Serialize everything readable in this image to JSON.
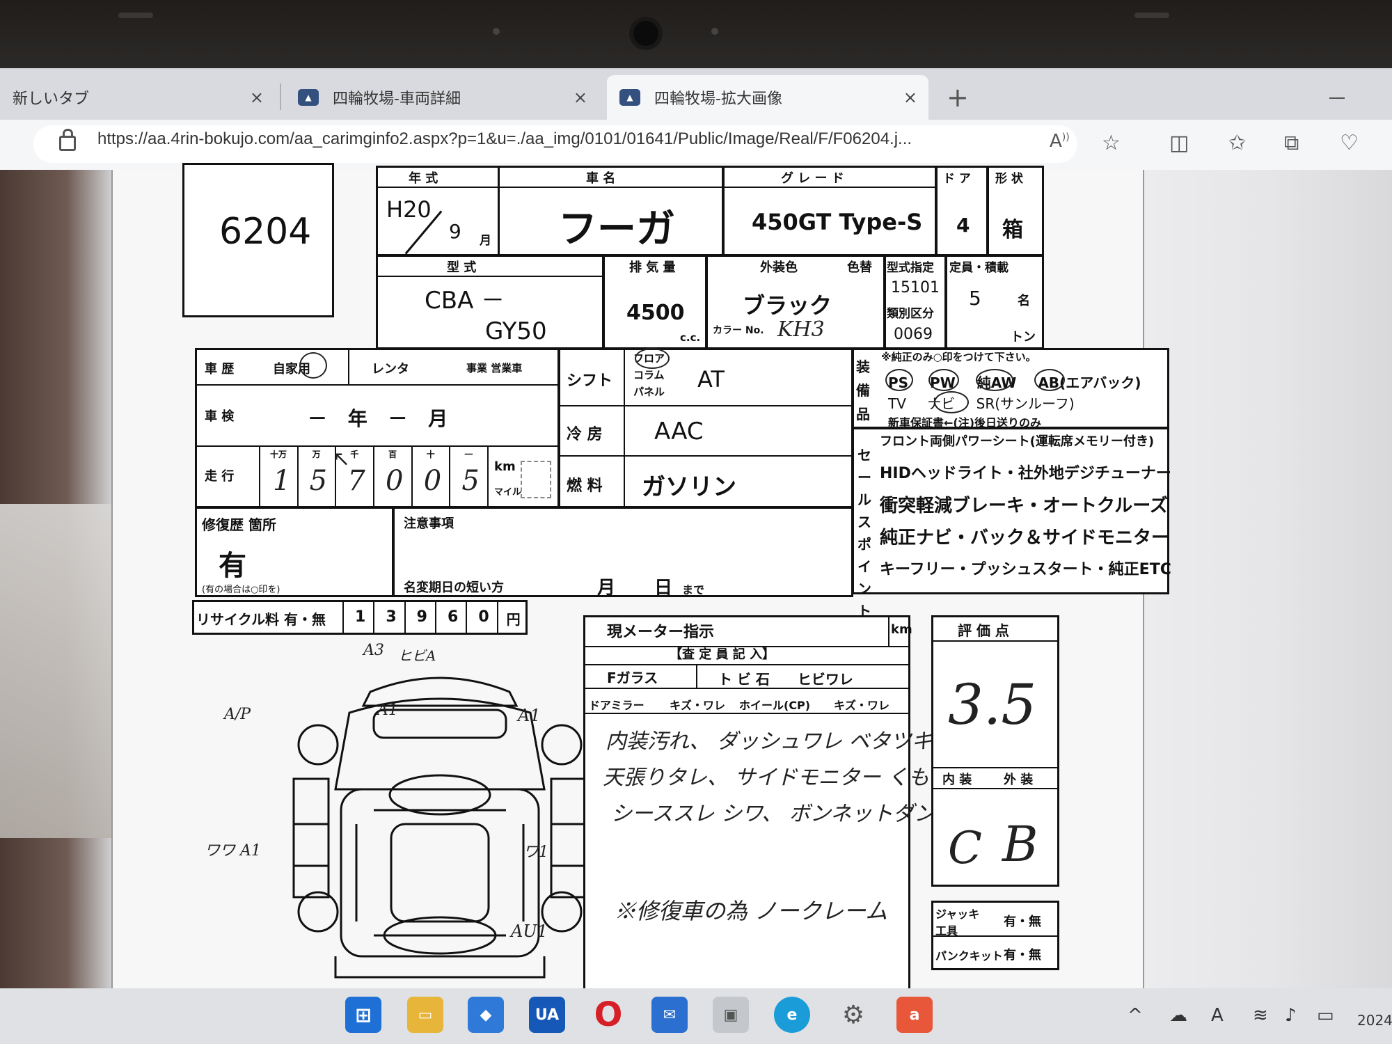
{
  "browser": {
    "tabs": [
      {
        "title": "新しいタブ",
        "active": false
      },
      {
        "title": "四輪牧場-車両詳細",
        "active": false
      },
      {
        "title": "四輪牧場-拡大画像",
        "active": true
      }
    ],
    "new_tab_label": "+",
    "close_label": "×",
    "url": "https://aa.4rin-bokujo.com/aa_carimginfo2.aspx?p=1&u=./aa_img/0101/01641/Public/Image/Real/F/F06204.j..."
  },
  "sheet": {
    "lot_number": "6204",
    "year": {
      "label": "年 式",
      "era_year": "H20",
      "month": "9",
      "month_unit": "月"
    },
    "car_name": {
      "label": "車 名",
      "value": "フーガ"
    },
    "grade": {
      "label": "グ レ ー ド",
      "value": "450GT Type-S"
    },
    "doors": {
      "label": "ド ア",
      "value": "4"
    },
    "body_shape": {
      "label": "形 状",
      "value": "箱"
    },
    "model": {
      "label": "型 式",
      "prefix": "CBA －",
      "code": "GY50"
    },
    "displacement": {
      "label": "排 気 量",
      "value": "4500",
      "unit": "c.c."
    },
    "exterior_color": {
      "label": "外装色",
      "swap_label": "色替",
      "value": "ブラック",
      "color_no_label": "カラー No.",
      "color_no": "KH3"
    },
    "type_designation": {
      "label": "型式指定",
      "value": "15101",
      "class_label": "類別区分",
      "class_value": "0069"
    },
    "capacity": {
      "label": "定員・積載",
      "persons": "5",
      "persons_unit": "名",
      "tons_unit": "トン"
    },
    "history": {
      "label": "車 歴",
      "options": [
        "自家用",
        "レンタ",
        "事業 営業車"
      ]
    },
    "inspection": {
      "label": "車 検",
      "value": "－ 年 － 月"
    },
    "mileage": {
      "label": "走 行",
      "digit_headers": [
        "十万",
        "万",
        "千",
        "百",
        "十",
        "一"
      ],
      "digits": [
        "1",
        "5",
        "7",
        "0",
        "0",
        "5"
      ],
      "unit_km": "km",
      "unit_mile": "マイル"
    },
    "shift": {
      "label": "シフト",
      "options": [
        "フロア",
        "コラム",
        "パネル"
      ],
      "value": "AT"
    },
    "aircon": {
      "label": "冷 房",
      "value": "AAC"
    },
    "fuel": {
      "label": "燃 料",
      "value": "ガソリン"
    },
    "equipment": {
      "label": "装備品",
      "note": "※純正のみ○印をつけて下さい。",
      "row1": [
        "PS",
        "PW",
        "純AW",
        "AB(エアバック)"
      ],
      "row2": [
        "TV",
        "ナビ",
        "SR(サンルーフ)"
      ],
      "row3": "新車保証書←(注)後日送りのみ"
    },
    "sales_points": {
      "label": "セールスポイント",
      "items": [
        "フロント両側パワーシート(運転席メモリー付き)",
        "HIDヘッドライト・社外地デジチューナー",
        "衝突軽減ブレーキ・オートクルーズ",
        "純正ナビ・バック＆サイドモニター",
        "キーフリー・プッシュスタート・純正ETC"
      ]
    },
    "repair": {
      "label": "修復歴 箇所",
      "value": "有",
      "note": "(有の場合は○印を)"
    },
    "notes": {
      "label": "注意事項",
      "deadline_label": "名変期日の短い方",
      "month": "月",
      "day": "日",
      "until": "まで"
    },
    "recycle": {
      "label": "リサイクル料 有・無",
      "digits": [
        "1",
        "3",
        "9",
        "6",
        "0"
      ],
      "unit": "円"
    },
    "meter": {
      "label": "現メーター指示",
      "unit": "km"
    },
    "inspector": {
      "label": "【査 定 員 記 入】",
      "glass_label": "Fガラス",
      "glass_options": "ト ビ 石　　ヒビワレ",
      "mirror_label": "ドアミラー",
      "mirror_options": "キズ・ワレ",
      "wheel_label": "ホイール(CP)",
      "wheel_options": "キズ・ワレ"
    },
    "remarks": [
      "内装汚れ、 ダッシュワレ ベタツキ",
      "天張りタレ、 サイドモニター くもり",
      "シーススレ シワ、 ボンネットダンパー不良",
      "※修復車の為 ノークレーム"
    ],
    "diagram_marks": [
      "A3",
      "ヒビA",
      "A1",
      "A1",
      "A1",
      "ワワ A1",
      "ワ1",
      "AU1",
      "A/P"
    ],
    "score": {
      "label": "評 価 点",
      "value": "3.5",
      "interior_label": "内 装",
      "exterior_label": "外 装",
      "interior": "C",
      "exterior": "B"
    },
    "jack": {
      "label": "ジャッキ 工具",
      "value": "有・無"
    },
    "puncture": {
      "label": "パンクキット",
      "value": "有・無"
    }
  },
  "taskbar": {
    "apps": [
      "start-icon",
      "file-explorer-icon",
      "app-icon",
      "UA",
      "opera-icon",
      "mail-icon",
      "photos-icon",
      "edge-icon",
      "settings-icon",
      "store-icon"
    ],
    "clock": "2024"
  }
}
